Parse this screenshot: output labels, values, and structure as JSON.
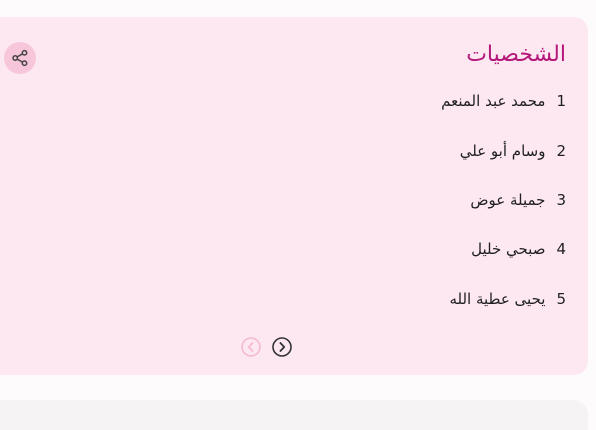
{
  "card": {
    "title": "الشخصيات",
    "accent_color": "#b5177a",
    "background": "#fde8f2"
  },
  "share": {
    "icon": "share-icon"
  },
  "characters": [
    {
      "number": "1",
      "name": "محمد عبد المنعم"
    },
    {
      "number": "2",
      "name": "وسام أبو علي"
    },
    {
      "number": "3",
      "name": "جميلة عوض"
    },
    {
      "number": "4",
      "name": "صبحي خليل"
    },
    {
      "number": "5",
      "name": "يحيى عطية الله"
    }
  ],
  "pager": {
    "prev_icon": "chevron-left-icon",
    "next_icon": "chevron-right-icon",
    "prev_disabled": true
  }
}
